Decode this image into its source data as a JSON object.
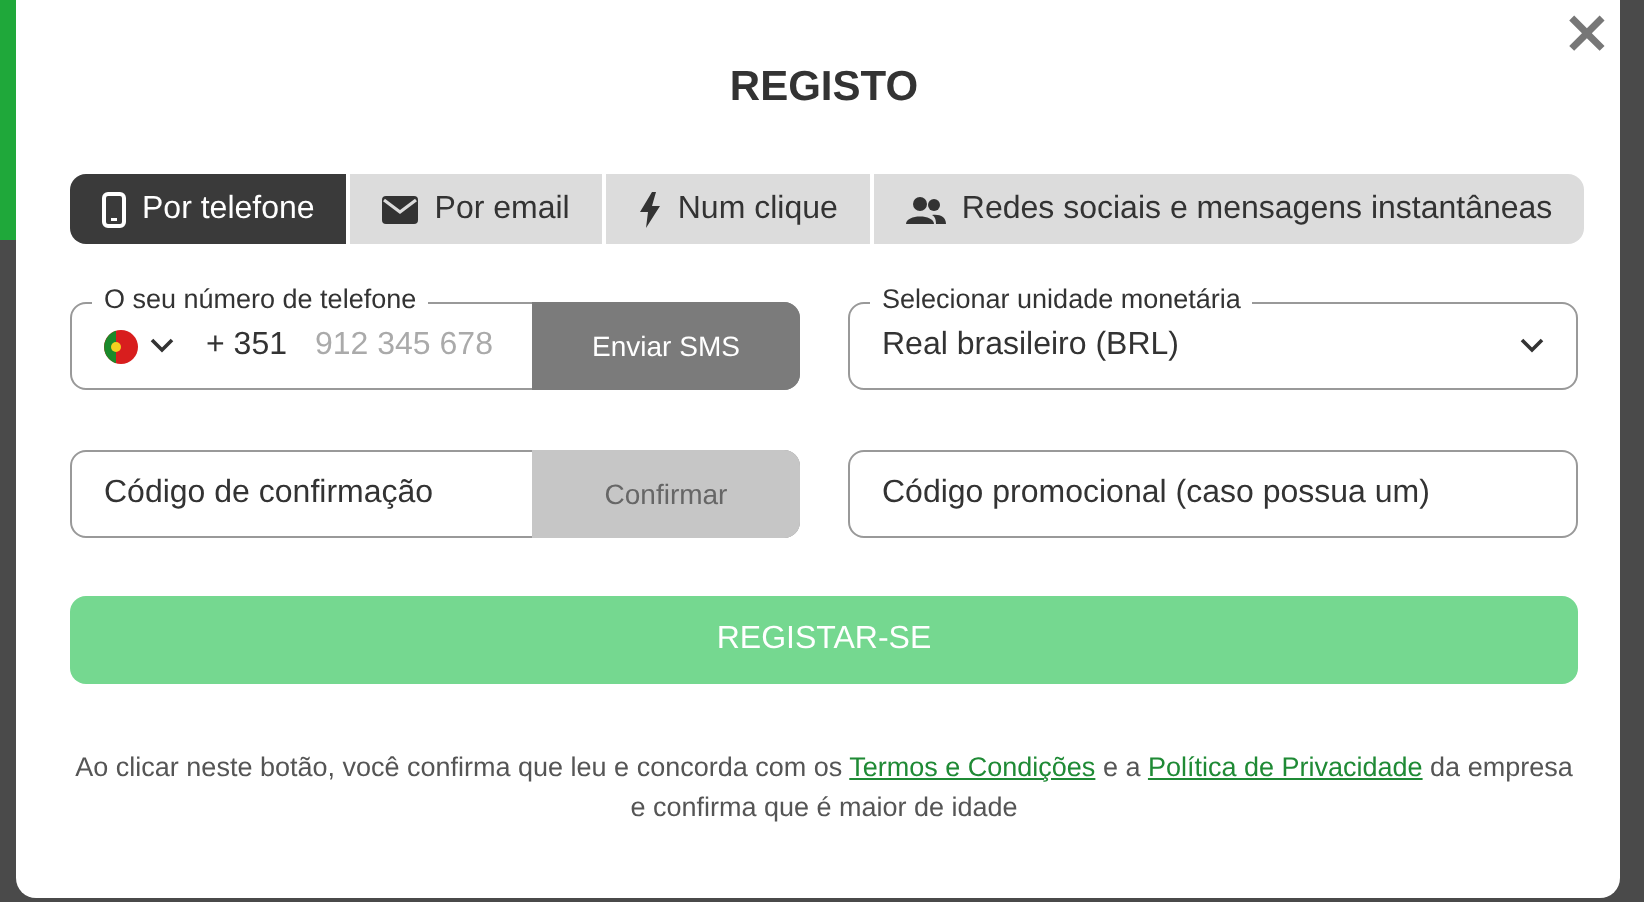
{
  "dialog": {
    "title": "REGISTO",
    "close": "×"
  },
  "tabs": [
    {
      "label": "Por telefone",
      "kind": "phone",
      "selected": true
    },
    {
      "label": "Por email",
      "kind": "email",
      "selected": false
    },
    {
      "label": "Num clique",
      "kind": "bolt",
      "selected": false
    },
    {
      "label": "Redes sociais e mensagens instantâneas",
      "kind": "social",
      "selected": false
    }
  ],
  "phone": {
    "label": "O seu número de telefone",
    "code": "+ 351",
    "placeholder": "912 345 678",
    "button": {
      "label": "Enviar SMS",
      "disabled": false
    }
  },
  "currency": {
    "label": "Selecionar unidade monetária",
    "value": "Real brasileiro (BRL)"
  },
  "confirmation": {
    "placeholder": "Código de confirmação",
    "button": {
      "label": "Confirmar",
      "disabled": true
    }
  },
  "promo": {
    "placeholder": "Código promocional (caso possua um)"
  },
  "submit": {
    "label": "REGISTAR-SE",
    "disabled": true
  },
  "notice": [
    {
      "kind": "text",
      "text": "Ao clicar neste botão, você confirma que leu e concorda com os "
    },
    {
      "kind": "link",
      "text": "Termos e Condições"
    },
    {
      "kind": "text",
      "text": " e a "
    },
    {
      "kind": "link",
      "text": "Política de Privacidade"
    },
    {
      "kind": "text",
      "text": " da empresa e confirma que é maior de idade"
    }
  ]
}
